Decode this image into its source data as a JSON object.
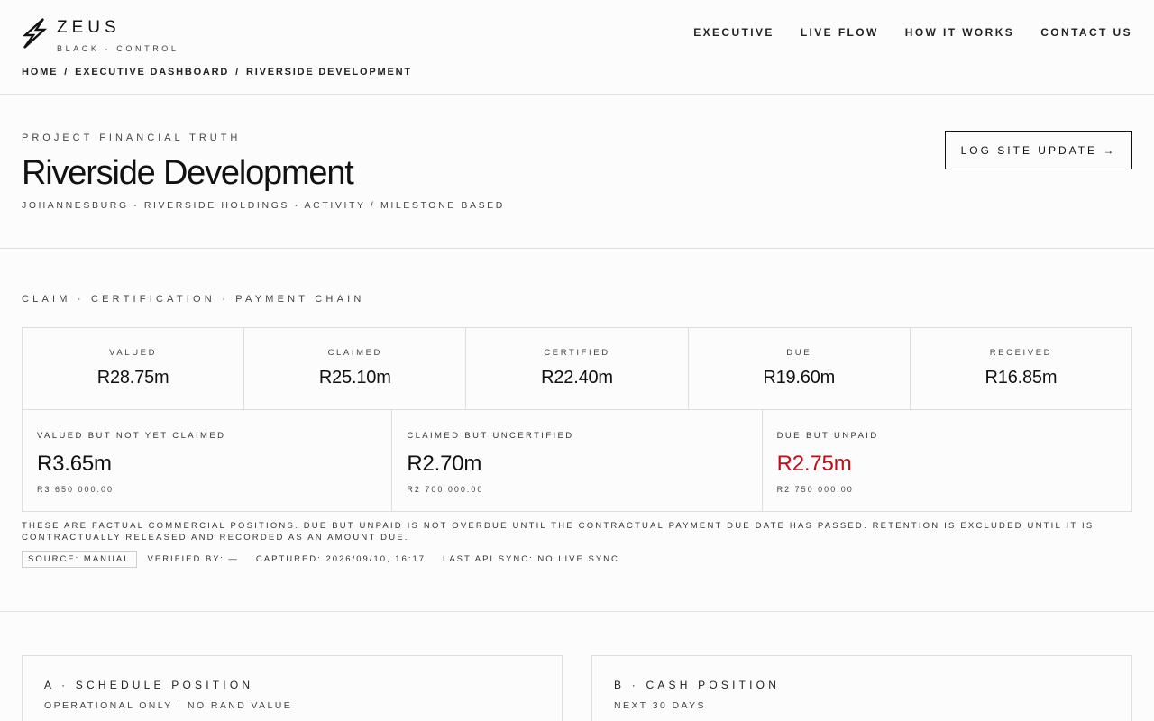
{
  "brand": {
    "name": "ZEUS",
    "tagline": "BLACK · CONTROL",
    "logo_icon": "lightning-bolt-icon"
  },
  "nav": {
    "items": [
      "EXECUTIVE",
      "LIVE FLOW",
      "HOW IT WORKS",
      "CONTACT US"
    ]
  },
  "breadcrumb": {
    "items": [
      "HOME",
      "EXECUTIVE DASHBOARD",
      "RIVERSIDE DEVELOPMENT"
    ],
    "separator": "/"
  },
  "hero": {
    "eyebrow": "PROJECT FINANCIAL TRUTH",
    "title": "Riverside Development",
    "subtitle": "JOHANNESBURG · RIVERSIDE HOLDINGS · ACTIVITY / MILESTONE BASED",
    "cta_label": "LOG SITE UPDATE →"
  },
  "chain": {
    "section_label": "CLAIM · CERTIFICATION · PAYMENT CHAIN",
    "stages": [
      {
        "label": "VALUED",
        "value": "R28.75m"
      },
      {
        "label": "CLAIMED",
        "value": "R25.10m"
      },
      {
        "label": "CERTIFIED",
        "value": "R22.40m"
      },
      {
        "label": "DUE",
        "value": "R19.60m"
      },
      {
        "label": "RECEIVED",
        "value": "R16.85m"
      }
    ],
    "gaps": [
      {
        "label": "VALUED BUT NOT YET CLAIMED",
        "value": "R3.65m",
        "exact": "R3 650 000.00"
      },
      {
        "label": "CLAIMED BUT UNCERTIFIED",
        "value": "R2.70m",
        "exact": "R2 700 000.00"
      },
      {
        "label": "DUE BUT UNPAID",
        "value": "R2.75m",
        "exact": "R2 750 000.00"
      }
    ],
    "alert_color": "#c10f1a",
    "note": "THESE ARE FACTUAL COMMERCIAL POSITIONS. DUE BUT UNPAID IS NOT OVERDUE UNTIL THE CONTRACTUAL PAYMENT DUE DATE HAS PASSED. RETENTION IS EXCLUDED UNTIL IT IS CONTRACTUALLY RELEASED AND RECORDED AS AN AMOUNT DUE.",
    "meta": {
      "source": "SOURCE: MANUAL",
      "verified": "VERIFIED BY: —",
      "captured": "CAPTURED: 2026/09/10, 16:17",
      "sync": "LAST API SYNC: NO LIVE SYNC"
    }
  },
  "cards": {
    "a": {
      "title": "A · SCHEDULE POSITION",
      "subtitle": "OPERATIONAL ONLY · NO RAND VALUE"
    },
    "b": {
      "title": "B · CASH POSITION",
      "subtitle": "NEXT 30 DAYS"
    }
  }
}
